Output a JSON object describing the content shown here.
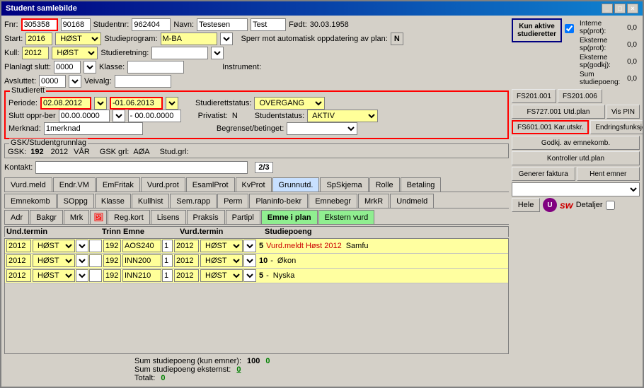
{
  "window": {
    "title": "Student samlebilde",
    "controls": [
      "_",
      "□",
      "×"
    ]
  },
  "header": {
    "fnr_label": "Fnr:",
    "fnr_value": "305358",
    "fnr2_value": "90168",
    "studentnr_label": "Studentnr:",
    "studentnr_value": "962404",
    "navn_label": "Navn:",
    "navn_value": "Testesen",
    "test_value": "Test",
    "fodt_label": "Født:",
    "fodt_value": "30.03.1958"
  },
  "start_row": {
    "start_label": "Start:",
    "start_year": "2016",
    "start_sem": "HØST",
    "studieprogram_label": "Studieprogram:",
    "studieprogram_value": "M-BA",
    "sperr_label": "Sperr mot automatisk oppdatering av plan:"
  },
  "kull_row": {
    "kull_label": "Kull:",
    "kull_year": "2012",
    "kull_sem": "HØST",
    "studieretning_label": "Studieretning:"
  },
  "planlagt_row": {
    "planlagt_label": "Planlagt slutt:",
    "planlagt_value": "0000",
    "klasse_label": "Klasse:",
    "instrument_label": "Instrument:"
  },
  "avsluttet_row": {
    "avsluttet_label": "Avsluttet:",
    "avsluttet_value": "0000",
    "veivalg_label": "Veivalg:"
  },
  "studierett": {
    "group_label": "Studierett",
    "periode_label": "Periode:",
    "periode_from": "02.08.2012",
    "periode_to": "-01.06.2013",
    "status_label": "Studierettstatus:",
    "status_value": "OVERGANG",
    "slutt_label": "Slutt oppr-ber",
    "slutt_from": "00.00.0000",
    "slutt_to": "- 00.00.0000",
    "privatist_label": "Privatist:",
    "privatist_value": "N",
    "studentstatus_label": "Studentstatus:",
    "studentstatus_value": "AKTIV",
    "merknad_label": "Merknad:",
    "merknad_value": "1merknad",
    "begrenset_label": "Begrenset/betinget:"
  },
  "gsk": {
    "group_label": "GSK/Studentgrunnlag",
    "gsk_label": "GSK:",
    "gsk_value": "192",
    "year": "2012",
    "sem": "VÅR",
    "gsk_grl_label": "GSK grl:",
    "gsk_grl_value": "AØA",
    "stud_grl_label": "Stud.grl:"
  },
  "kontakt": {
    "label": "Kontakt:",
    "counter": "2/3"
  },
  "right_panel": {
    "kun_aktive_label": "Kun aktive studieretter",
    "interne_label": "Interne sp(prot):",
    "interne_value": "0,0",
    "eksterne_label": "Eksterne sp(prot):",
    "eksterne_value": "0,0",
    "eksterne_godkj_label": "Eksterne sp(godkj):",
    "eksterne_godkj_value": "0,0",
    "sum_label": "Sum studiepoeng:",
    "sum_value": "0,0",
    "btn_fs201001": "FS201.001",
    "btn_fs201006": "FS201.006",
    "btn_fs727": "FS727.001 Utd.plan",
    "btn_vis_pin": "Vis PIN",
    "btn_fs601": "FS601.001 Kar.utskr.",
    "btn_endring": "Endringsfunksjoner",
    "btn_godkj": "Godkj. av emnekomb.",
    "btn_kontroller": "Kontroller utd.plan",
    "btn_generer": "Generer faktura",
    "btn_hent": "Hent emner",
    "btn_hele": "Hele",
    "btn_detaljer": "Detaljer"
  },
  "tabs1": {
    "items": [
      {
        "label": "Vurd.meld",
        "active": false
      },
      {
        "label": "Endr.VM",
        "active": false
      },
      {
        "label": "EmFritak",
        "active": false
      },
      {
        "label": "Vurd.prot",
        "active": false
      },
      {
        "label": "EsamlProt",
        "active": false
      },
      {
        "label": "KvProt",
        "active": false
      },
      {
        "label": "Grunnutd.",
        "active": true
      },
      {
        "label": "SpSkjema",
        "active": false
      },
      {
        "label": "Rolle",
        "active": false
      },
      {
        "label": "Betaling",
        "active": false
      }
    ]
  },
  "tabs2": {
    "items": [
      {
        "label": "Emnekomb",
        "active": false
      },
      {
        "label": "SOppg",
        "active": false
      },
      {
        "label": "Klasse",
        "active": false
      },
      {
        "label": "Kullhist",
        "active": false
      },
      {
        "label": "Sem.rapp",
        "active": false
      },
      {
        "label": "Perm",
        "active": false
      },
      {
        "label": "Planinfo-bekr",
        "active": false
      },
      {
        "label": "Emnebegr",
        "active": false
      },
      {
        "label": "MrkR",
        "active": false
      },
      {
        "label": "Undmeld",
        "active": false
      }
    ]
  },
  "tabs3": {
    "items": [
      {
        "label": "Adr",
        "active": false
      },
      {
        "label": "Bakgr",
        "active": false
      },
      {
        "label": "Mrk",
        "active": false
      },
      {
        "label": "img",
        "active": false
      },
      {
        "label": "Reg.kort",
        "active": false
      },
      {
        "label": "Lisens",
        "active": false
      },
      {
        "label": "Praksis",
        "active": false
      },
      {
        "label": "Partipl",
        "active": false
      },
      {
        "label": "Emne i plan",
        "active": true
      },
      {
        "label": "Ekstern vurd",
        "active": false
      }
    ]
  },
  "table": {
    "headers": [
      "Und.termin",
      "",
      "",
      "",
      "Trinn",
      "Emne",
      "",
      "Vurd.termin",
      "",
      "Studiepoeng",
      ""
    ],
    "rows": [
      {
        "und_year": "2012",
        "und_sem": "HØST",
        "trinn": "192",
        "emne": "AOS240",
        "col": "1",
        "vurd_year": "2012",
        "vurd_sem": "HØST",
        "sp": "5",
        "info": "Vurd.meldt Høst 2012",
        "extra": "Samfu"
      },
      {
        "und_year": "2012",
        "und_sem": "HØST",
        "trinn": "192",
        "emne": "INN200",
        "col": "1",
        "vurd_year": "2012",
        "vurd_sem": "HØST",
        "sp": "10",
        "info": "-",
        "extra": "Økon"
      },
      {
        "und_year": "2012",
        "und_sem": "HØST",
        "trinn": "192",
        "emne": "INN210",
        "col": "1",
        "vurd_year": "2012",
        "vurd_sem": "HØST",
        "sp": "5",
        "info": "-",
        "extra": "Nyska"
      }
    ]
  },
  "sums": {
    "sum_emner_label": "Sum studiepoeng (kun emner):",
    "sum_emner_value": "100",
    "sum_emner_green": "0",
    "sum_ekstern_label": "Sum studiepoeng eksternst:",
    "sum_ekstern_value": "0",
    "totalt_label": "Totalt:",
    "totalt_value": "0"
  }
}
